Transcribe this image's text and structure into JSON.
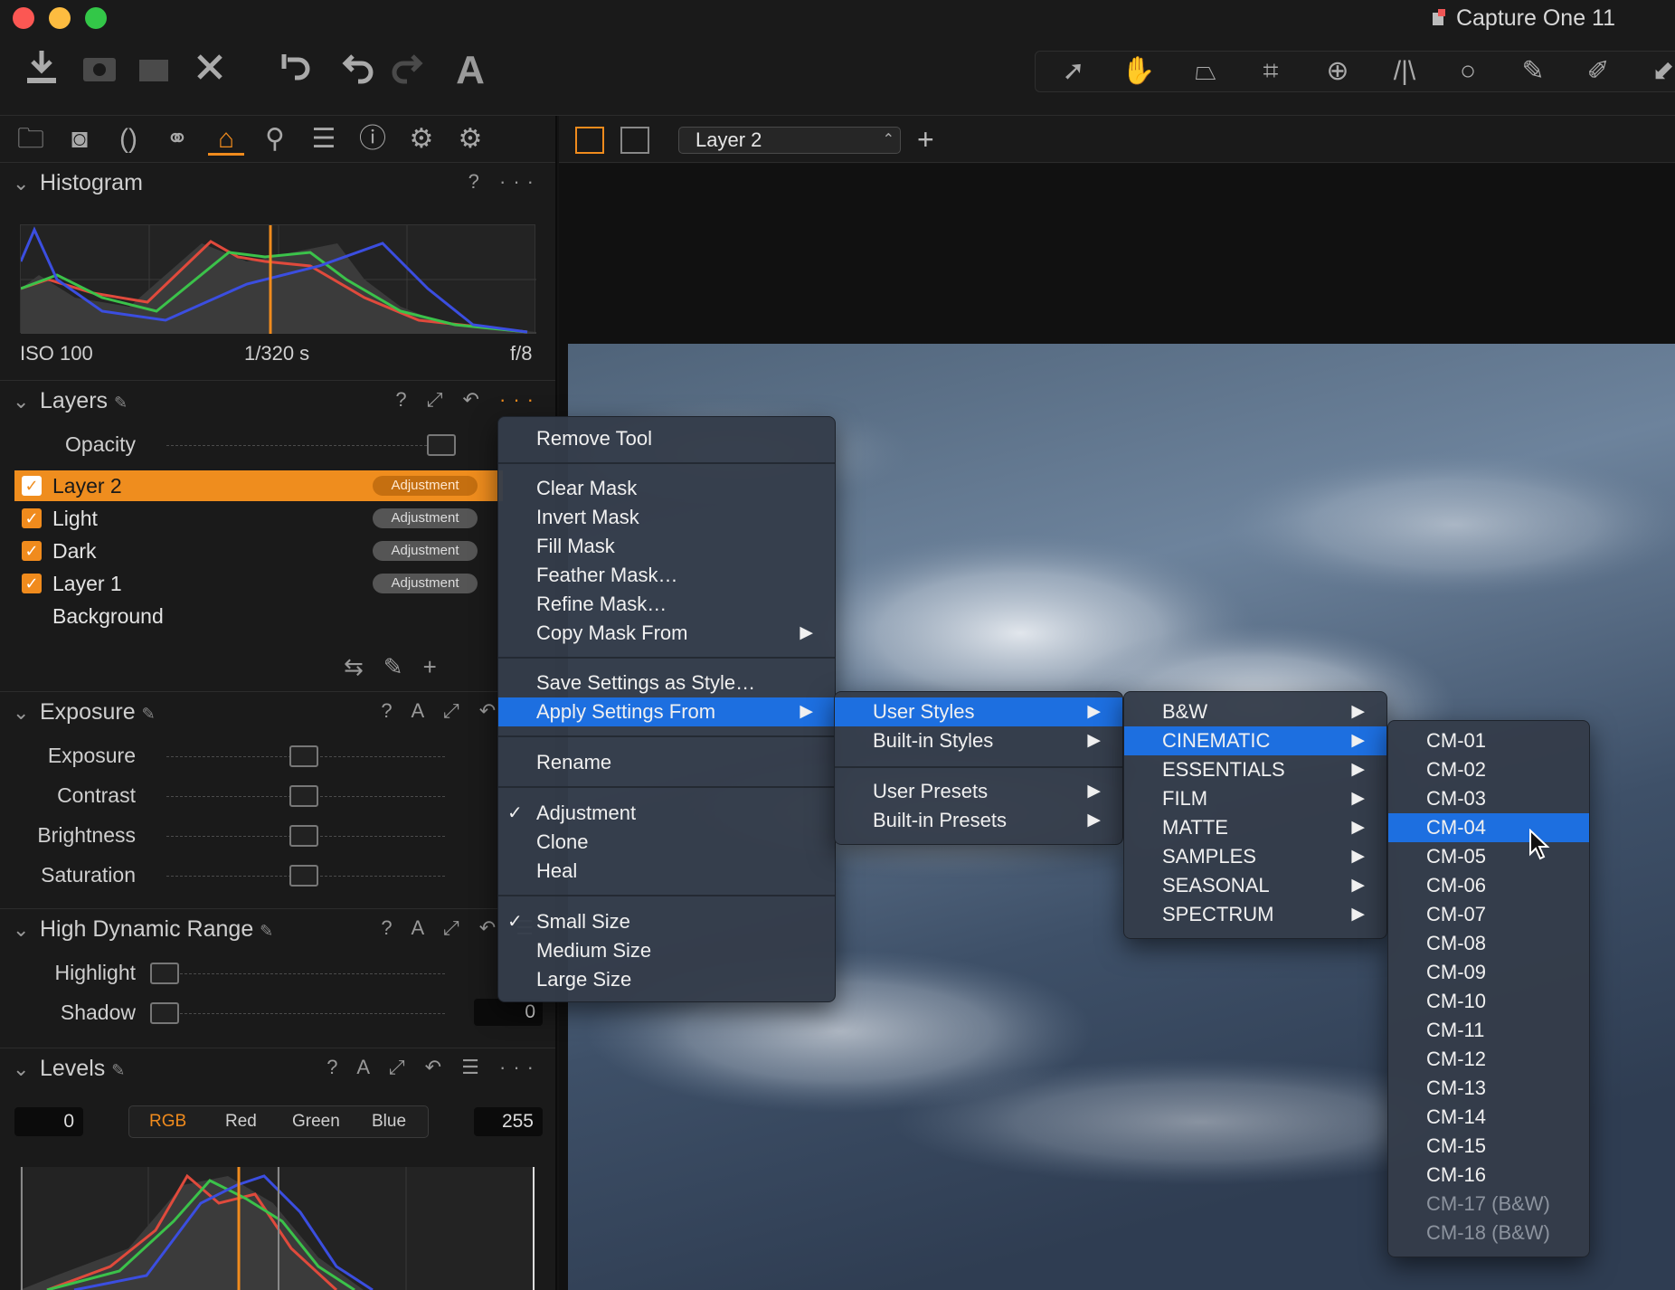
{
  "app": {
    "title": "Capture One 11"
  },
  "histogram": {
    "title": "Histogram",
    "iso": "ISO 100",
    "shutter": "1/320 s",
    "aperture": "f/8"
  },
  "layers": {
    "title": "Layers",
    "opacity_label": "Opacity",
    "items": [
      {
        "name": "Layer 2",
        "badge": "Adjustment",
        "checked": true,
        "selected": true
      },
      {
        "name": "Light",
        "badge": "Adjustment",
        "checked": true,
        "selected": false
      },
      {
        "name": "Dark",
        "badge": "Adjustment",
        "checked": true,
        "selected": false
      },
      {
        "name": "Layer 1",
        "badge": "Adjustment",
        "checked": true,
        "selected": false
      },
      {
        "name": "Background"
      }
    ]
  },
  "exposure": {
    "title": "Exposure",
    "sliders": [
      "Exposure",
      "Contrast",
      "Brightness",
      "Saturation"
    ]
  },
  "hdr": {
    "title": "High Dynamic Range",
    "sliders": [
      "Highlight",
      "Shadow"
    ],
    "shadow_value": "0"
  },
  "levels": {
    "title": "Levels",
    "low": "0",
    "high": "255",
    "tabs": [
      "RGB",
      "Red",
      "Green",
      "Blue"
    ]
  },
  "viewer": {
    "layer_select": "Layer 2"
  },
  "context_menu": {
    "items": [
      "Remove Tool",
      "Clear Mask",
      "Invert Mask",
      "Fill Mask",
      "Feather Mask…",
      "Refine Mask…",
      "Copy Mask From",
      "Save Settings as Style…",
      "Apply Settings From",
      "Rename",
      "Adjustment",
      "Clone",
      "Heal",
      "Small Size",
      "Medium Size",
      "Large Size"
    ]
  },
  "apply_submenu": {
    "items": [
      "User Styles",
      "Built-in Styles",
      "User Presets",
      "Built-in Presets"
    ]
  },
  "user_styles_submenu": {
    "items": [
      "B&W",
      "CINEMATIC",
      "ESSENTIALS",
      "FILM",
      "MATTE",
      "SAMPLES",
      "SEASONAL",
      "SPECTRUM"
    ]
  },
  "cinematic_submenu": {
    "items": [
      "CM-01",
      "CM-02",
      "CM-03",
      "CM-04",
      "CM-05",
      "CM-06",
      "CM-07",
      "CM-08",
      "CM-09",
      "CM-10",
      "CM-11",
      "CM-12",
      "CM-13",
      "CM-14",
      "CM-15",
      "CM-16",
      "CM-17 (B&W)",
      "CM-18 (B&W)"
    ],
    "highlighted": "CM-04"
  },
  "colors": {
    "accent": "#f08b1d",
    "menu_highlight": "#1d6fe0",
    "menu_bg": "#343c4a"
  },
  "icons": [
    "import-icon",
    "camera-icon",
    "folder-move-icon",
    "delete-icon",
    "undo-all-icon",
    "undo-icon",
    "redo-icon",
    "text-icon",
    "select-cursor-icon",
    "pan-hand-icon",
    "loupe-icon",
    "crop-icon",
    "rotate-icon",
    "keystone-icon",
    "circle-icon",
    "brush-icon",
    "picker-icon"
  ]
}
